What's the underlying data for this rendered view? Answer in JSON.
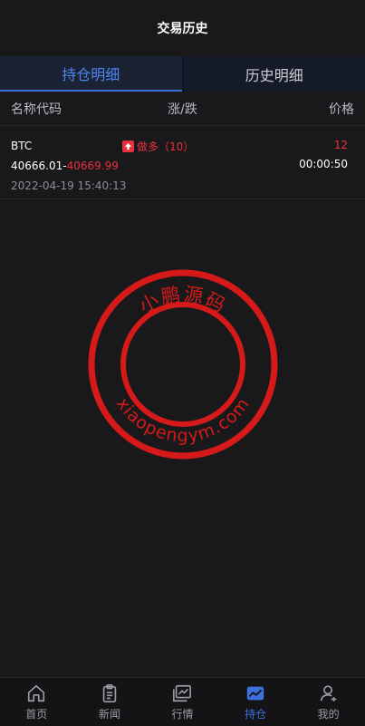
{
  "header": {
    "title": "交易历史"
  },
  "tabs": [
    {
      "label": "持仓明细",
      "active": true
    },
    {
      "label": "历史明细",
      "active": false
    }
  ],
  "columns": {
    "name": "名称代码",
    "change": "涨/跌",
    "price": "价格"
  },
  "positions": [
    {
      "symbol": "BTC",
      "direction": "做多（10）",
      "price": "12",
      "open_price": "40666.01",
      "separator": "-",
      "current_price": "40669.99",
      "countdown": "00:00:50",
      "date": "2022-04-19 15:40:13"
    }
  ],
  "watermark": {
    "top_text": "小鹏源码",
    "bottom_text": "xiaopengym.com",
    "color": "#d61a1a"
  },
  "tabbar": [
    {
      "label": "首页",
      "icon": "home-icon",
      "active": false
    },
    {
      "label": "新闻",
      "icon": "news-icon",
      "active": false
    },
    {
      "label": "行情",
      "icon": "market-icon",
      "active": false
    },
    {
      "label": "持仓",
      "icon": "position-icon",
      "active": true
    },
    {
      "label": "我的",
      "icon": "user-icon",
      "active": false
    }
  ],
  "colors": {
    "accent": "#3d6fe0",
    "up": "#e8313d",
    "background": "#19191b"
  }
}
